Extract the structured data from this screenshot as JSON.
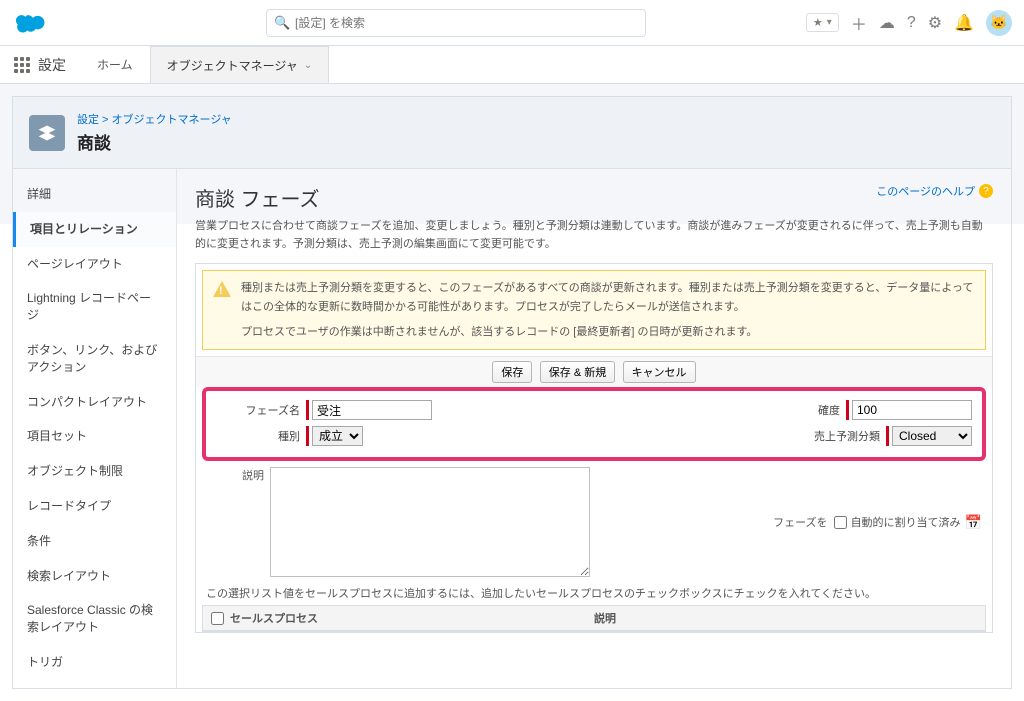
{
  "search": {
    "placeholder": "[設定] を検索"
  },
  "app": {
    "name": "設定"
  },
  "nav": {
    "home": "ホーム",
    "objmgr": "オブジェクトマネージャ"
  },
  "breadcrumb": {
    "root": "設定",
    "om": "オブジェクトマネージャ"
  },
  "object_title": "商談",
  "sidebar": {
    "items": [
      "詳細",
      "項目とリレーション",
      "ページレイアウト",
      "Lightning レコードページ",
      "ボタン、リンク、およびアクション",
      "コンパクトレイアウト",
      "項目セット",
      "オブジェクト制限",
      "レコードタイプ",
      "条件",
      "検索レイアウト",
      "Salesforce Classic の検索レイアウト",
      "トリガ"
    ]
  },
  "page": {
    "title": "商談 フェーズ",
    "help": "このページのヘルプ",
    "desc": "営業プロセスに合わせて商談フェーズを追加、変更しましょう。種別と予測分類は連動しています。商談が進みフェーズが変更されるに伴って、売上予測も自動的に変更されます。予測分類は、売上予測の編集画面にて変更可能です。",
    "warn1": "種別または売上予測分類を変更すると、このフェーズがあるすべての商談が更新されます。種別または売上予測分類を変更すると、データ量によってはこの全体的な更新に数時間かかる可能性があります。プロセスが完了したらメールが送信されます。",
    "warn2": "プロセスでユーザの作業は中断されませんが、該当するレコードの [最終更新者] の日時が更新されます。"
  },
  "buttons": {
    "save": "保存",
    "saveNew": "保存 & 新規",
    "cancel": "キャンセル"
  },
  "form": {
    "nameLabel": "フェーズ名",
    "nameValue": "受注",
    "typeLabel": "種別",
    "typeValue": "成立",
    "probLabel": "確度",
    "probValue": "100",
    "fcLabel": "売上予測分類",
    "fcValue": "Closed",
    "descLabel": "説明",
    "assignLabel": "フェーズを",
    "assignText": "自動的に割り当て済み"
  },
  "listNote": "この選択リスト値をセールスプロセスに追加するには、追加したいセールスプロセスのチェックボックスにチェックを入れてください。",
  "table": {
    "col1": "セールスプロセス",
    "col2": "説明"
  },
  "colors": {
    "accent": "#e6316f"
  }
}
